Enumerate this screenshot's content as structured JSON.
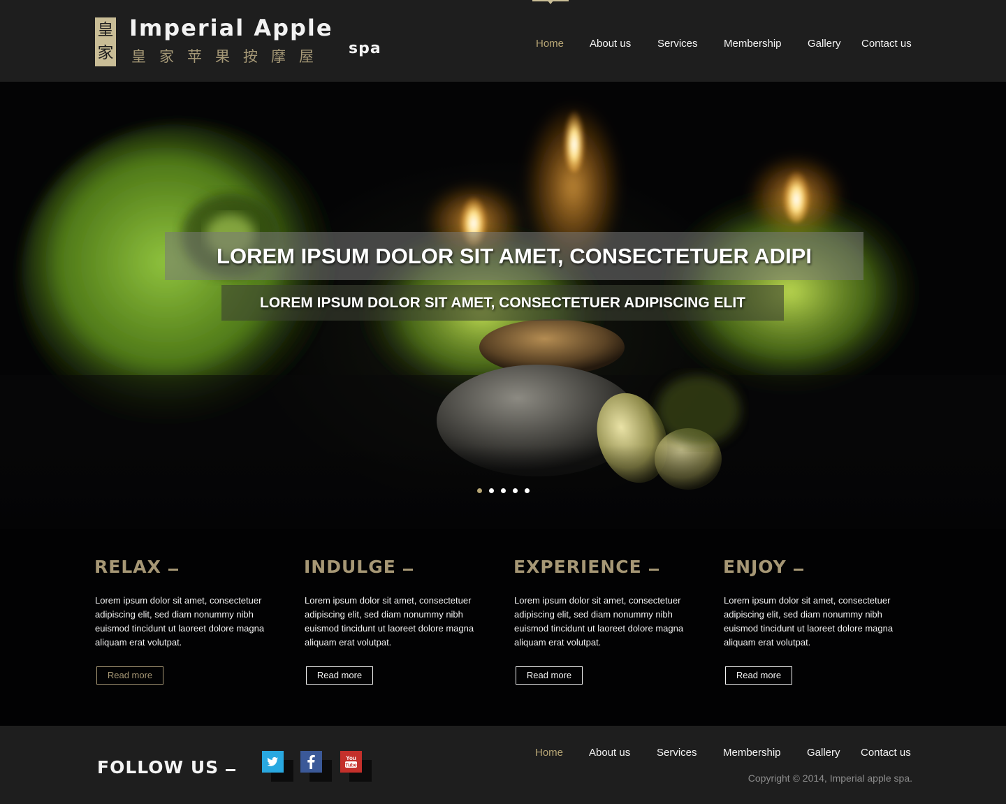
{
  "brand": {
    "seal": [
      "皇",
      "家"
    ],
    "title": "Imperial Apple",
    "subtitle_cn": "皇家苹果按摩屋",
    "spa": "spa"
  },
  "nav": {
    "items": [
      "Home",
      "About us",
      "Services",
      "Membership",
      "Gallery",
      "Contact us"
    ],
    "active": "Home"
  },
  "hero": {
    "heading": "LOREM IPSUM DOLOR SIT AMET, CONSECTETUER ADIPI",
    "subheading": "LOREM IPSUM DOLOR SIT AMET, CONSECTETUER ADIPISCING ELIT",
    "slide_count": 5,
    "active_slide": 1
  },
  "features": [
    {
      "title": "RELAX",
      "text": "Lorem ipsum dolor sit amet, consectetuer adipiscing elit, sed diam nonummy nibh euismod tincidunt ut laoreet dolore magna aliquam erat volutpat.",
      "button": "Read more"
    },
    {
      "title": "INDULGE",
      "text": "Lorem ipsum dolor sit amet, consectetuer adipiscing elit, sed diam nonummy nibh euismod tincidunt ut laoreet dolore magna aliquam erat volutpat.",
      "button": "Read more"
    },
    {
      "title": "EXPERIENCE",
      "text": "Lorem ipsum dolor sit amet, consectetuer adipiscing elit, sed diam nonummy nibh euismod tincidunt ut laoreet dolore magna aliquam erat volutpat.",
      "button": "Read more"
    },
    {
      "title": "ENJOY",
      "text": "Lorem ipsum dolor sit amet, consectetuer adipiscing elit, sed diam nonummy nibh euismod tincidunt ut laoreet dolore magna aliquam erat volutpat.",
      "button": "Read more"
    }
  ],
  "footer": {
    "follow_label": "FOLLOW US",
    "social": [
      {
        "name": "twitter-icon",
        "color": "#29a8e0"
      },
      {
        "name": "facebook-icon",
        "color": "#3b5998"
      },
      {
        "name": "youtube-icon",
        "color": "#c4302b"
      }
    ],
    "nav": [
      "Home",
      "About us",
      "Services",
      "Membership",
      "Gallery",
      "Contact us"
    ],
    "copyright": "Copyright © 2014, Imperial apple spa."
  },
  "colors": {
    "accent": "#b7a675",
    "header_bg": "#1e1e1e",
    "page_bg": "#020203"
  }
}
